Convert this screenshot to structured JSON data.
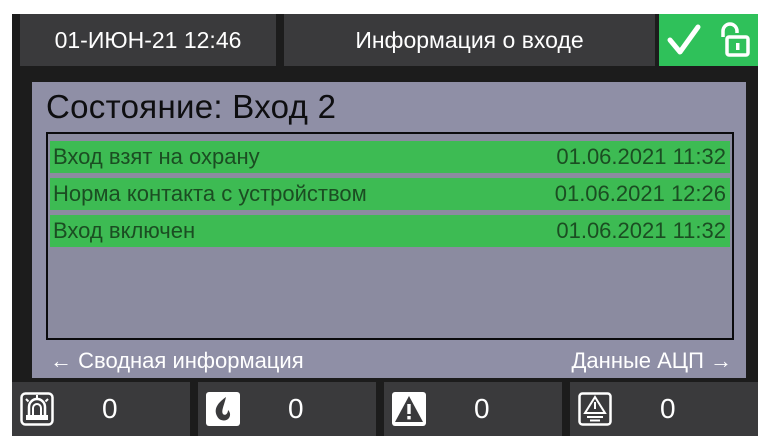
{
  "header": {
    "datetime": "01-ИЮН-21 12:46",
    "title": "Информация о входе",
    "status_icons": [
      "checkmark-icon",
      "unlocked-padlock-icon"
    ],
    "status_color": "#2fc15a"
  },
  "panel": {
    "title": "Состояние: Вход 2",
    "events": [
      {
        "text": "Вход взят на охрану",
        "time": "01.06.2021 11:32"
      },
      {
        "text": "Норма контакта с устройством",
        "time": "01.06.2021 12:26"
      },
      {
        "text": "Вход включен",
        "time": "01.06.2021 11:32"
      }
    ],
    "row_color": "#3dbb53",
    "nav_left": "← Сводная информация",
    "nav_right": "Данные АЦП →"
  },
  "footer": {
    "counters": [
      {
        "icon": "alarm-siren-icon",
        "value": "0"
      },
      {
        "icon": "fire-icon",
        "value": "0"
      },
      {
        "icon": "warning-triangle-icon",
        "value": "0"
      },
      {
        "icon": "fault-triangle-icon",
        "value": "0"
      }
    ]
  }
}
